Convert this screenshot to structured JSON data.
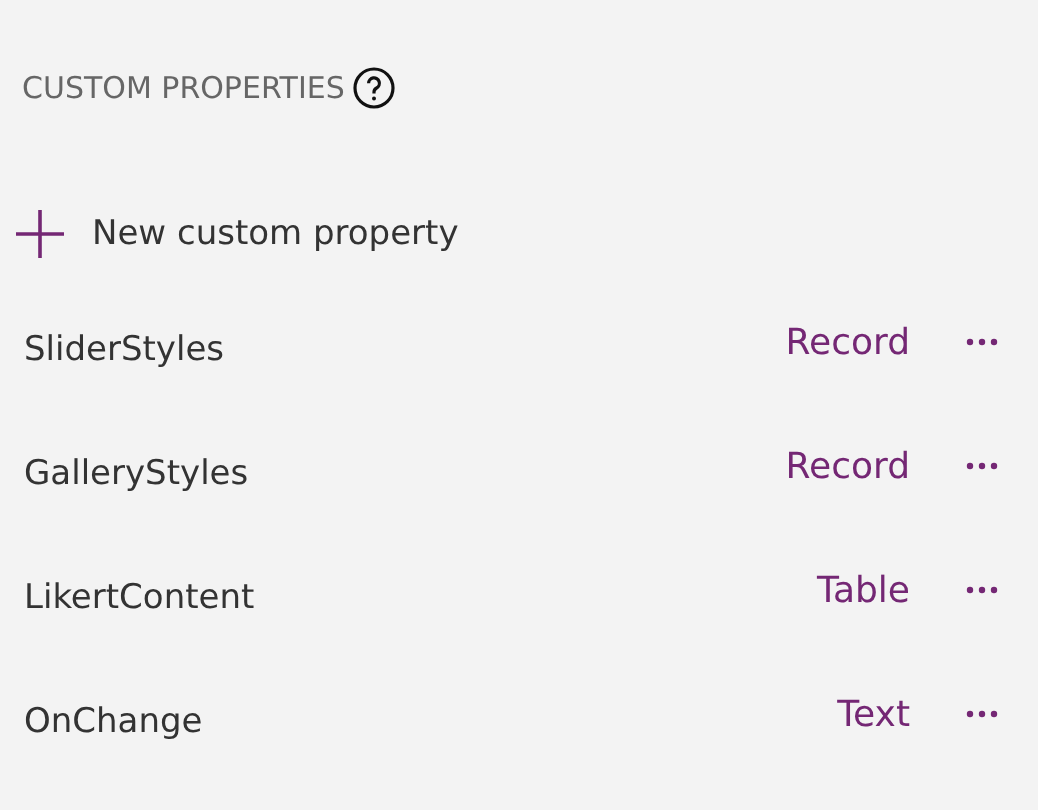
{
  "section": {
    "title": "CUSTOM PROPERTIES"
  },
  "add_button": {
    "label": "New custom property"
  },
  "properties": [
    {
      "name": "SliderStyles",
      "type": "Record"
    },
    {
      "name": "GalleryStyles",
      "type": "Record"
    },
    {
      "name": "LikertContent",
      "type": "Table"
    },
    {
      "name": "OnChange",
      "type": "Text"
    }
  ]
}
